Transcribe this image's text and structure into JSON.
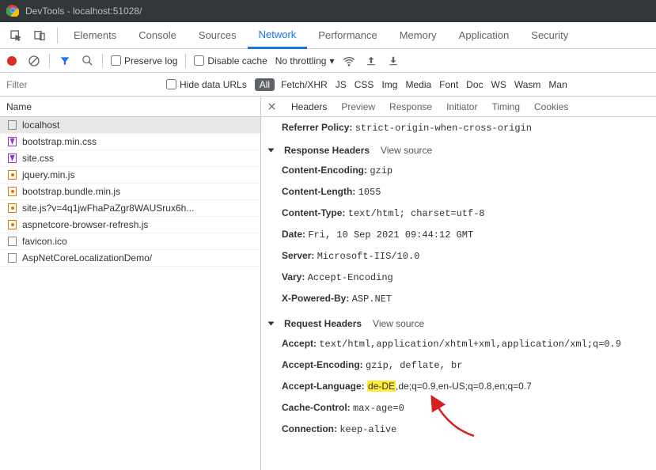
{
  "window": {
    "title": "DevTools - localhost:51028/"
  },
  "tabs": {
    "items": [
      "Elements",
      "Console",
      "Sources",
      "Network",
      "Performance",
      "Memory",
      "Application",
      "Security"
    ],
    "active": "Network"
  },
  "toolbar": {
    "preserve_log": "Preserve log",
    "disable_cache": "Disable cache",
    "throttling": "No throttling"
  },
  "filterbar": {
    "placeholder": "Filter",
    "hide_data_urls": "Hide data URLs",
    "all": "All",
    "types": [
      "Fetch/XHR",
      "JS",
      "CSS",
      "Img",
      "Media",
      "Font",
      "Doc",
      "WS",
      "Wasm",
      "Man"
    ]
  },
  "request_list": {
    "header": "Name",
    "rows": [
      {
        "name": "localhost",
        "icon": "doc",
        "selected": true
      },
      {
        "name": "bootstrap.min.css",
        "icon": "css"
      },
      {
        "name": "site.css",
        "icon": "css"
      },
      {
        "name": "jquery.min.js",
        "icon": "js"
      },
      {
        "name": "bootstrap.bundle.min.js",
        "icon": "js"
      },
      {
        "name": "site.js?v=4q1jwFhaPaZgr8WAUSrux6h...",
        "icon": "js"
      },
      {
        "name": "aspnetcore-browser-refresh.js",
        "icon": "js"
      },
      {
        "name": "favicon.ico",
        "icon": "other"
      },
      {
        "name": "AspNetCoreLocalizationDemo/",
        "icon": "other"
      }
    ]
  },
  "subtabs": {
    "items": [
      "Headers",
      "Preview",
      "Response",
      "Initiator",
      "Timing",
      "Cookies"
    ],
    "active": "Headers"
  },
  "details": {
    "referrer_policy_label": "Referrer Policy:",
    "referrer_policy_value": "strict-origin-when-cross-origin",
    "response_headers_title": "Response Headers",
    "view_source": "View source",
    "response_headers": [
      {
        "name": "Content-Encoding:",
        "value": "gzip"
      },
      {
        "name": "Content-Length:",
        "value": "1055"
      },
      {
        "name": "Content-Type:",
        "value": "text/html; charset=utf-8"
      },
      {
        "name": "Date:",
        "value": "Fri, 10 Sep 2021 09:44:12 GMT"
      },
      {
        "name": "Server:",
        "value": "Microsoft-IIS/10.0"
      },
      {
        "name": "Vary:",
        "value": "Accept-Encoding"
      },
      {
        "name": "X-Powered-By:",
        "value": "ASP.NET"
      }
    ],
    "request_headers_title": "Request Headers",
    "request_headers": {
      "accept": {
        "name": "Accept:",
        "value": "text/html,application/xhtml+xml,application/xml;q=0.9"
      },
      "accept_encoding": {
        "name": "Accept-Encoding:",
        "value": "gzip, deflate, br"
      },
      "accept_language": {
        "name": "Accept-Language:",
        "hl": "de-DE",
        "rest": ",de;q=0.9,en-US;q=0.8,en;q=0.7"
      },
      "cache_control": {
        "name": "Cache-Control:",
        "value": "max-age=0"
      },
      "connection": {
        "name": "Connection:",
        "value": "keep-alive"
      }
    }
  }
}
